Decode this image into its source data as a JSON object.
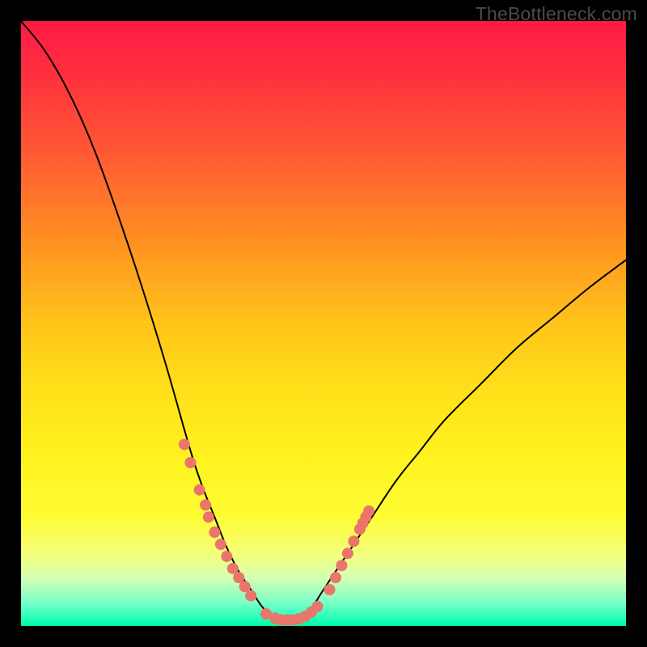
{
  "watermark": "TheBottleneck.com",
  "colors": {
    "frame": "#000000",
    "curve_stroke": "#000000",
    "marker_fill": "#e9756b",
    "marker_stroke": "#e9756b"
  },
  "chart_data": {
    "type": "line",
    "title": "",
    "xlabel": "",
    "ylabel": "",
    "xlim": [
      0,
      100
    ],
    "ylim": [
      0,
      100
    ],
    "curve_note": "V-shaped bottleneck curve; y-values are percentage heights (0=bottom, 100=top). Minimum near x≈44.",
    "x": [
      0,
      4,
      8,
      12,
      16,
      20,
      24,
      28,
      30,
      32,
      34,
      36,
      38,
      40,
      42,
      44,
      46,
      48,
      50,
      54,
      58,
      62,
      66,
      70,
      76,
      82,
      88,
      94,
      100
    ],
    "values": [
      100,
      95,
      88,
      79,
      68,
      56,
      43,
      29,
      23,
      18,
      13,
      9,
      6,
      3,
      1.5,
      1,
      1.5,
      3,
      6,
      12,
      18,
      24,
      29,
      34,
      40,
      46,
      51,
      56,
      60.5
    ],
    "markers_note": "Salmon dots/segments near the valley. y is percentage height.",
    "markers": [
      {
        "x": 27.0,
        "y": 30.0
      },
      {
        "x": 28.0,
        "y": 27.0
      },
      {
        "x": 29.5,
        "y": 22.5
      },
      {
        "x": 30.5,
        "y": 20.0
      },
      {
        "x": 31.0,
        "y": 18.0
      },
      {
        "x": 32.0,
        "y": 15.5
      },
      {
        "x": 33.0,
        "y": 13.5
      },
      {
        "x": 34.0,
        "y": 11.5
      },
      {
        "x": 35.0,
        "y": 9.5
      },
      {
        "x": 36.0,
        "y": 8.0
      },
      {
        "x": 37.0,
        "y": 6.5
      },
      {
        "x": 38.0,
        "y": 5.0
      },
      {
        "x": 40.5,
        "y": 2.0
      },
      {
        "x": 42.0,
        "y": 1.3
      },
      {
        "x": 43.0,
        "y": 1.0
      },
      {
        "x": 44.0,
        "y": 1.0
      },
      {
        "x": 45.0,
        "y": 1.0
      },
      {
        "x": 46.0,
        "y": 1.2
      },
      {
        "x": 47.0,
        "y": 1.6
      },
      {
        "x": 48.0,
        "y": 2.3
      },
      {
        "x": 49.0,
        "y": 3.2
      },
      {
        "x": 51.0,
        "y": 6.0
      },
      {
        "x": 52.0,
        "y": 8.0
      },
      {
        "x": 53.0,
        "y": 10.0
      },
      {
        "x": 54.0,
        "y": 12.0
      },
      {
        "x": 55.0,
        "y": 14.0
      },
      {
        "x": 56.0,
        "y": 16.0
      },
      {
        "x": 56.5,
        "y": 17.0
      },
      {
        "x": 57.0,
        "y": 18.0
      },
      {
        "x": 57.5,
        "y": 19.0
      }
    ]
  }
}
